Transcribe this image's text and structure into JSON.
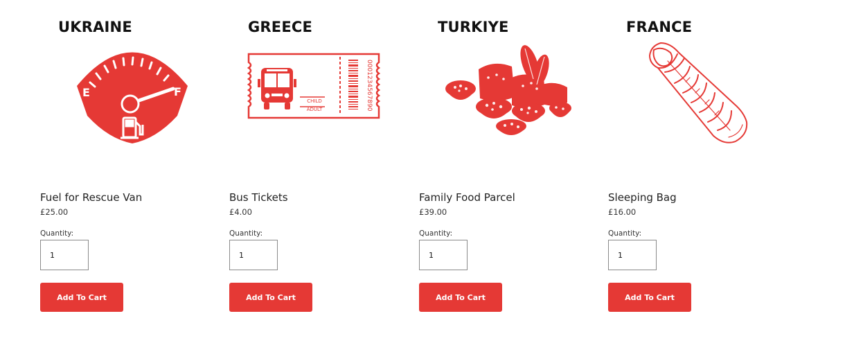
{
  "accent_color": "#e53935",
  "products": [
    {
      "country": "UKRAINE",
      "icon": "fuel-gauge-icon",
      "icon_text": {
        "empty": "E",
        "full": "F"
      },
      "name": "Fuel for Rescue Van",
      "price": "£25.00",
      "quantity_label": "Quantity:",
      "quantity": "1",
      "button_label": "Add To Cart"
    },
    {
      "country": "GREECE",
      "icon": "bus-ticket-icon",
      "icon_text": {
        "child": "CHILD",
        "adult": "ADULT",
        "serial": "0001234567890"
      },
      "name": "Bus Tickets",
      "price": "£4.00",
      "quantity_label": "Quantity:",
      "quantity": "1",
      "button_label": "Add To Cart"
    },
    {
      "country": "TURKIYE",
      "icon": "food-parcel-icon",
      "name": "Family Food Parcel",
      "price": "£39.00",
      "quantity_label": "Quantity:",
      "quantity": "1",
      "button_label": "Add To Cart"
    },
    {
      "country": "FRANCE",
      "icon": "sleeping-bag-icon",
      "name": "Sleeping Bag",
      "price": "£16.00",
      "quantity_label": "Quantity:",
      "quantity": "1",
      "button_label": "Add To Cart"
    }
  ]
}
